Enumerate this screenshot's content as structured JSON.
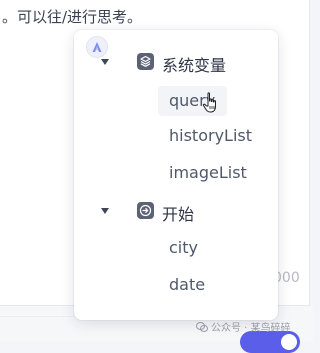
{
  "editor": {
    "text": "。可以往/进行思考。",
    "char_count": "000"
  },
  "variable_menu": {
    "groups": [
      {
        "label": "系统变量",
        "icon": "cube-icon",
        "items": [
          "query",
          "historyList",
          "imageList"
        ]
      },
      {
        "label": "开始",
        "icon": "start-arrow-icon",
        "items": [
          "city",
          "date"
        ]
      }
    ],
    "hovered_item": "query"
  },
  "watermark": {
    "text": "公众号 · 某鸟碎碎"
  },
  "colors": {
    "accent": "#5b5ee8",
    "icon_bg": "#5b6274",
    "hover_bg": "#f3f4f7"
  }
}
